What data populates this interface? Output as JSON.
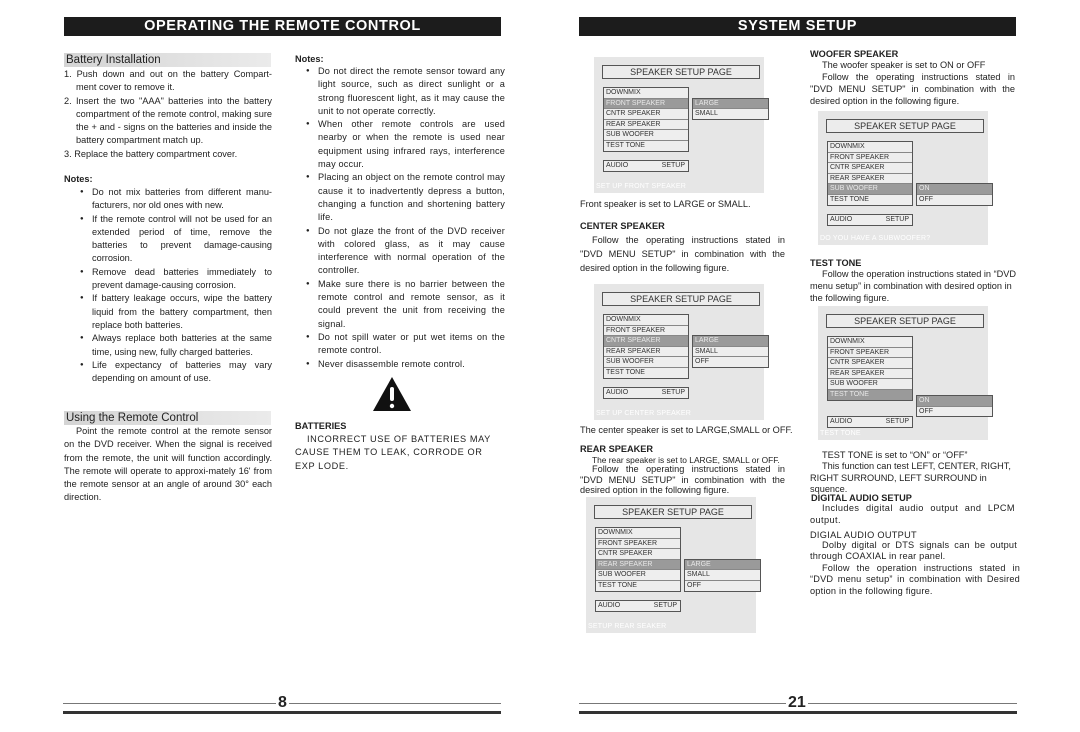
{
  "left_page": {
    "banner": "OPERATING THE REMOTE CONTROL",
    "battery_installation": {
      "heading": "Battery Installation",
      "steps": [
        "1. Push down and out on the  battery Compart-ment cover to remove it.",
        "2. Insert the two \"AAA\" batteries into the battery compartment of the remote control,  making sure the + and - signs on the batteries and inside  the battery compartment match up.",
        "3. Replace the battery compartment cover."
      ]
    },
    "battery_notes": {
      "heading": "Notes:",
      "items": [
        "Do not mix batteries from different manu-facturers, nor old ones with new.",
        "If the remote control will not be used for an extended period of time, remove the batteries to prevent damage-causing corrosion.",
        "Remove  dead batteries immediately to prevent damage-causing corrosion.",
        "If battery leakage occurs, wipe the battery liquid from the battery compartment, then replace both batteries.",
        "Always replace both batteries at the same time, using new, fully charged batteries.",
        "Life expectancy of batteries may vary depending on amount of use."
      ]
    },
    "using_remote": {
      "heading": "Using the Remote Control",
      "body": "Point the remote control at the remote sensor on the DVD receiver. When the signal is received from the remote, the unit will function accordingly. The remote will operate to approxi-mately 16' from the remote sensor at an angle of around 30° each direction."
    },
    "remote_notes": {
      "heading": "Notes:",
      "items": [
        "Do not direct the remote sensor toward any light source,  such as direct sunlight or a strong fluorescent light,  as it may cause the unit to not operate correctly.",
        "When other remote controls are used nearby or when the remote is used near equipment using infrared rays, interference may occur.",
        "Placing an object on the remote control may cause it to inadvertently depress a button, changing a function and shortening battery life.",
        "Do not glaze the front of the DVD receiver with colored glass,  as it may cause interference with normal operation of the controller.",
        "Make sure there is no barrier between the remote control and remote sensor,  as it could prevent the unit from receiving the signal.",
        "Do not spill water or put wet items on the remote control.",
        "Never disassemble remote control."
      ]
    },
    "warning_icon": "warning-triangle-icon",
    "batteries_warning": {
      "heading": "BATTERIES",
      "body": "INCORRECT  USE  OF  BATTERIES  MAY CAUSE THEM TO LEAK, CORRODE OR EXP LODE."
    },
    "page_number": "8"
  },
  "right_page": {
    "banner": "SYSTEM SETUP",
    "screens": [
      {
        "id": "front",
        "title": "SPEAKER SETUP PAGE",
        "menu": [
          "DOWNMIX",
          "FRONT SPEAKER",
          "CNTR SPEAKER",
          "REAR SPEAKER",
          "SUB WOOFER",
          "TEST TONE"
        ],
        "selected_menu": 1,
        "options": [
          "LARGE",
          "SMALL"
        ],
        "selected_option": 0,
        "footer_left": "AUDIO",
        "footer_right": "SETUP",
        "hint": "SET UP FRONT SPEAKER"
      },
      {
        "id": "center",
        "title": "SPEAKER SETUP PAGE",
        "menu": [
          "DOWNMIX",
          "FRONT SPEAKER",
          "CNTR  SPEAKER",
          "REAR SPEAKER",
          "SUB WOOFER",
          "TEST TONE"
        ],
        "selected_menu": 2,
        "options": [
          "LARGE",
          "SMALL",
          "OFF"
        ],
        "selected_option": 0,
        "footer_left": "AUDIO",
        "footer_right": "SETUP",
        "hint": "SET UP CENTER SPEAKER"
      },
      {
        "id": "rear",
        "title": "SPEAKER SETUP PAGE",
        "menu": [
          "DOWNMIX",
          "FRONT SPEAKER",
          "CNTR SPEAKER",
          "REAR SPEAKER",
          "SUB WOOFER",
          "TEST TONE"
        ],
        "selected_menu": 3,
        "options": [
          "LARGE",
          "SMALL",
          "OFF"
        ],
        "selected_option": 0,
        "footer_left": "AUDIO",
        "footer_right": "SETUP",
        "hint": "SETUP REAR SEAKER"
      },
      {
        "id": "woofer",
        "title": "SPEAKER SETUP PAGE",
        "menu": [
          "DOWNMIX",
          "FRONT SPEAKER",
          "CNTR SPEAKER",
          "REAR SPEAKER",
          "SUB WOOFER",
          "TEST TONE"
        ],
        "selected_menu": 4,
        "options": [
          "ON",
          "OFF"
        ],
        "selected_option": 0,
        "footer_left": "AUDIO",
        "footer_right": "SETUP",
        "hint": "DO YOU HAVE A SUBWOOFER?"
      },
      {
        "id": "testtone",
        "title": "SPEAKER SETUP PAGE",
        "menu": [
          "DOWNMIX",
          "FRONT SPEAKER",
          "CNTR SPEAKER",
          "REAR SPEAKER",
          "SUB WOOFER",
          "TEST TONE"
        ],
        "selected_menu": 5,
        "options": [
          "ON",
          "OFF"
        ],
        "selected_option": 0,
        "footer_left": "AUDIO",
        "footer_right": "SETUP",
        "hint": "TEST TONE"
      }
    ],
    "front_caption": "Front speaker is set to LARGE or SMALL.",
    "center": {
      "heading": "CENTER SPEAKER",
      "body": "Follow the operating instructions stated in \"DVD MENU SETUP\" in combination with the desired option in the following figure.",
      "caption": "The center speaker is set to LARGE,SMALL or OFF."
    },
    "rear": {
      "heading": "REAR SPEAKER",
      "line1": "The rear speaker is set to LARGE, SMALL or OFF.",
      "body": "Follow the operating instructions stated in \"DVD MENU SETUP\" in combination with the desired option in the following figure."
    },
    "woofer": {
      "heading": "WOOFER SPEAKER",
      "line1": "The woofer speaker is set to ON or OFF",
      "body": "Follow the operating instructions stated in \"DVD MENU SETUP\" in combination with the desired option in the following figure."
    },
    "test_tone": {
      "heading": "TEST TONE",
      "body": "Follow the operation instructions stated in “DVD menu setup” in combination with desired option in the following figure.",
      "caption1": "TEST TONE is set to “ON” or “OFF”",
      "caption2": "This function can  test LEFT,  CENTER,  RIGHT, RIGHT SURROUND, LEFT SURROUND in squence."
    },
    "digital_audio_setup": {
      "heading": "DIGITAL AUDIO SETUP",
      "body": "Includes digital audio output and LPCM output."
    },
    "digital_audio_output": {
      "heading": "DIGIAL AUDIO OUTPUT",
      "body1": "Dolby digital or DTS signals can be output through COAXIAL in rear panel.",
      "body2": "Follow the operation instructions stated in “DVD menu setup” in combination with Desired option in the following figure."
    },
    "page_number": "21"
  }
}
